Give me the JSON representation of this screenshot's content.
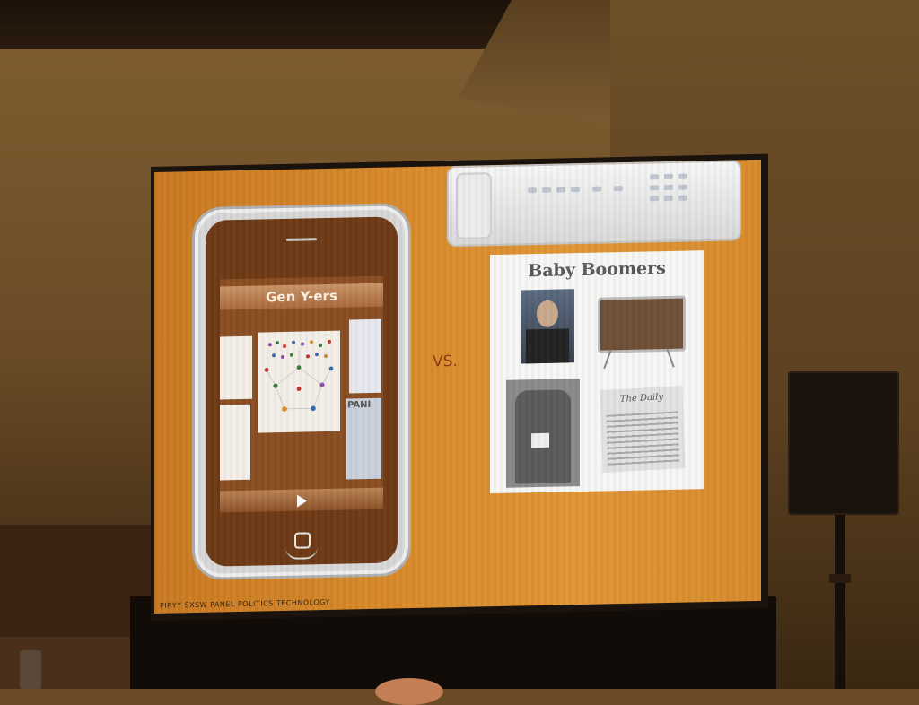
{
  "slide": {
    "phone_title": "Gen Y-ers",
    "vs_label": "VS.",
    "paper_title": "Baby Boomers",
    "newspaper_title": "The Daily",
    "card_title_right": "PANI",
    "footer": "PIRYY SXSW PANEL POLITICS TECHNOLOGY"
  },
  "colors": {
    "slide_background": "#d88a2a",
    "vs_text": "#8a3b14"
  },
  "icons": {
    "play": "play-icon",
    "home": "home-button-icon"
  }
}
